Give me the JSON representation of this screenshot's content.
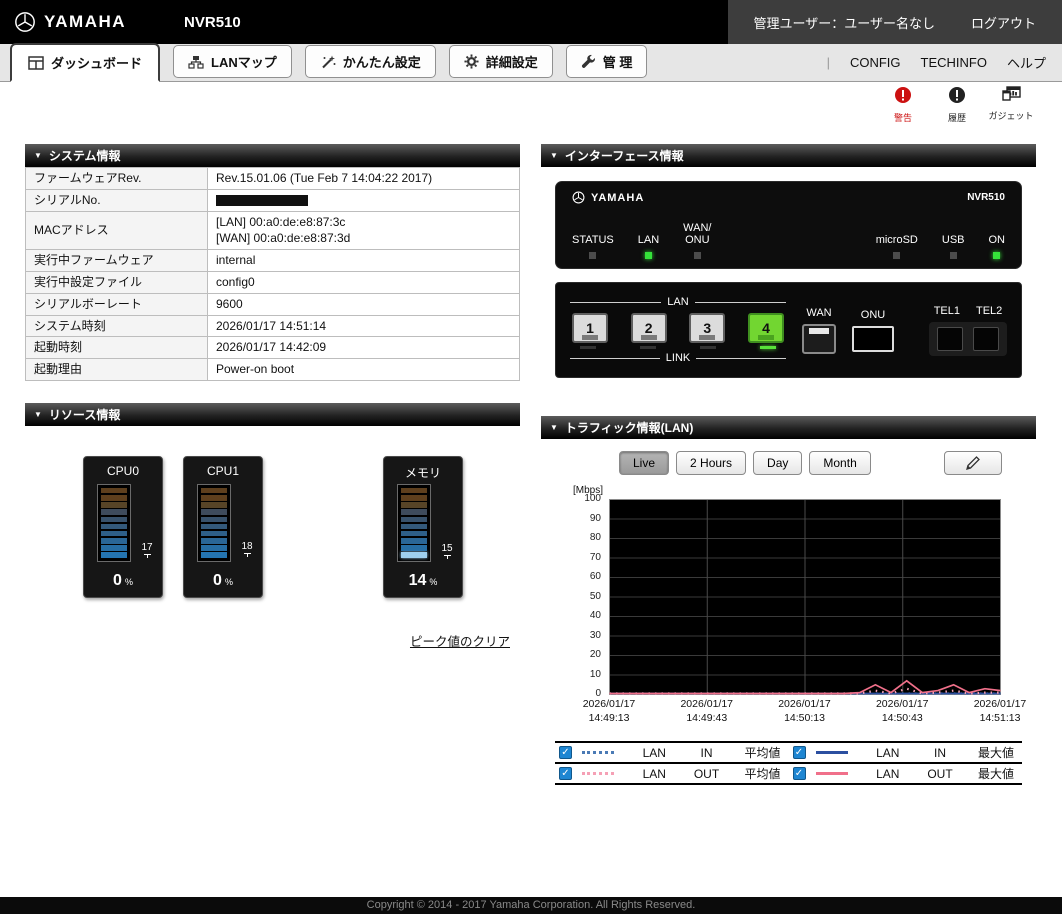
{
  "header": {
    "brand": "YAMAHA",
    "model": "NVR510",
    "user_label": "管理ユーザー：ユーザー名なし",
    "logout_label": "ログアウト"
  },
  "tabs": [
    {
      "id": "dashboard",
      "label": "ダッシュボード",
      "icon": "dashboard-icon",
      "active": true
    },
    {
      "id": "lanmap",
      "label": "LANマップ",
      "icon": "lanmap-icon",
      "active": false
    },
    {
      "id": "easy-setup",
      "label": "かんたん設定",
      "icon": "wand-icon",
      "active": false
    },
    {
      "id": "advanced",
      "label": "詳細設定",
      "icon": "gear-icon",
      "active": false
    },
    {
      "id": "admin",
      "label": "管 理",
      "icon": "wrench-icon",
      "active": false
    }
  ],
  "top_links": [
    {
      "id": "config",
      "label": "CONFIG"
    },
    {
      "id": "techinfo",
      "label": "TECHINFO"
    },
    {
      "id": "help",
      "label": "ヘルプ"
    }
  ],
  "notices": [
    {
      "id": "warning",
      "label": "警告",
      "icon": "warning-icon",
      "color": "#cc1111"
    },
    {
      "id": "history",
      "label": "履歴",
      "icon": "history-icon",
      "color": "#222222"
    },
    {
      "id": "gadget",
      "label": "ガジェット",
      "icon": "gadget-icon",
      "color": "#222222"
    }
  ],
  "system_info": {
    "title": "システム情報",
    "rows": [
      {
        "label": "ファームウェアRev.",
        "value": "Rev.15.01.06 (Tue Feb 7 14:04:22 2017)"
      },
      {
        "label": "シリアルNo.",
        "value": "",
        "redacted": true
      },
      {
        "label": "MACアドレス",
        "value": "[LAN] 00:a0:de:e8:87:3c\n[WAN] 00:a0:de:e8:87:3d"
      },
      {
        "label": "実行中ファームウェア",
        "value": "internal"
      },
      {
        "label": "実行中設定ファイル",
        "value": "config0"
      },
      {
        "label": "シリアルボーレート",
        "value": "9600"
      },
      {
        "label": "システム時刻",
        "value": "2026/01/17 14:51:14"
      },
      {
        "label": "起動時刻",
        "value": "2026/01/17 14:42:09"
      },
      {
        "label": "起動理由",
        "value": "Power-on boot"
      }
    ]
  },
  "resource_info": {
    "title": "リソース情報",
    "clear_link": "ピーク値のクリア",
    "gauges": [
      {
        "name": "CPU0",
        "value": 0,
        "unit": "%",
        "peak": 17
      },
      {
        "name": "CPU1",
        "value": 0,
        "unit": "%",
        "peak": 18
      },
      {
        "name": "メモリ",
        "value": 14,
        "unit": "%",
        "peak": 15
      }
    ]
  },
  "interface_info": {
    "title": "インターフェース情報",
    "front": {
      "brand": "YAMAHA",
      "model": "NVR510",
      "leds": [
        {
          "label": "STATUS",
          "on": false
        },
        {
          "label": "LAN",
          "on": true
        },
        {
          "label": "WAN/\nONU",
          "on": false
        },
        {
          "label": "microSD",
          "on": false
        },
        {
          "label": "USB",
          "on": false
        },
        {
          "label": "ON",
          "on": true
        }
      ]
    },
    "rear": {
      "lan_label": "LAN",
      "link_label": "LINK",
      "lan_ports": [
        {
          "number": "1",
          "active": false
        },
        {
          "number": "2",
          "active": false
        },
        {
          "number": "3",
          "active": false
        },
        {
          "number": "4",
          "active": true
        }
      ],
      "wan_label": "WAN",
      "onu_label": "ONU",
      "tel_labels": [
        "TEL1",
        "TEL2"
      ]
    }
  },
  "traffic": {
    "title": "トラフィック情報(LAN)",
    "buttons": [
      {
        "label": "Live",
        "active": true
      },
      {
        "label": "2 Hours",
        "active": false
      },
      {
        "label": "Day",
        "active": false
      },
      {
        "label": "Month",
        "active": false
      }
    ],
    "edit_icon": "pencil-icon",
    "legend": [
      {
        "interface": "LAN",
        "direction": "IN",
        "stat": "平均値",
        "style": "dotted",
        "color": "#4a7ab5",
        "checked": true
      },
      {
        "interface": "LAN",
        "direction": "IN",
        "stat": "最大値",
        "style": "solid",
        "color": "#2b4fa0",
        "checked": true
      },
      {
        "interface": "LAN",
        "direction": "OUT",
        "stat": "平均値",
        "style": "dotted",
        "color": "#f5a0b5",
        "checked": true
      },
      {
        "interface": "LAN",
        "direction": "OUT",
        "stat": "最大値",
        "style": "solid",
        "color": "#f0708a",
        "checked": true
      }
    ]
  },
  "chart_data": {
    "type": "line",
    "title": "トラフィック情報(LAN)",
    "ylabel": "[Mbps]",
    "xlabel": "",
    "ylim": [
      0,
      100
    ],
    "ytick_step": 10,
    "grid": true,
    "plot_bg": "#000000",
    "legend_position": "bottom",
    "x_labels": [
      "2026/01/17\n14:49:13",
      "2026/01/17\n14:49:43",
      "2026/01/17\n14:50:13",
      "2026/01/17\n14:50:43",
      "2026/01/17\n14:51:13"
    ],
    "series": [
      {
        "name": "LAN IN 平均値",
        "style": "dotted",
        "color": "#4a7ab5",
        "values": [
          0,
          0,
          0,
          0,
          0,
          0,
          0,
          0,
          0,
          0,
          0,
          0,
          0,
          0,
          0,
          0,
          0,
          0,
          0,
          0,
          0,
          0,
          0,
          0,
          0,
          0
        ]
      },
      {
        "name": "LAN IN 最大値",
        "style": "solid",
        "color": "#2b4fa0",
        "values": [
          0,
          0,
          0,
          0,
          0,
          0,
          0,
          0,
          0,
          0,
          0,
          0,
          0,
          0,
          0,
          0,
          0,
          0,
          0,
          0,
          0,
          0,
          0,
          0,
          0,
          0
        ]
      },
      {
        "name": "LAN OUT 平均値",
        "style": "dotted",
        "color": "#f5a0b5",
        "values": [
          0,
          0,
          0,
          0,
          0,
          0,
          0,
          0,
          0,
          0,
          0,
          0,
          0,
          0,
          0,
          0,
          0.5,
          2,
          0.5,
          3,
          0.5,
          1,
          2,
          0.5,
          1,
          1
        ]
      },
      {
        "name": "LAN OUT 最大値",
        "style": "solid",
        "color": "#f0708a",
        "values": [
          0,
          0,
          0,
          0,
          0,
          0,
          0,
          0,
          0,
          0,
          0,
          0,
          0,
          0,
          0,
          0,
          1,
          5,
          1,
          7,
          1,
          2,
          5,
          1,
          3,
          2
        ]
      }
    ]
  },
  "footer": {
    "copyright": "Copyright © 2014 - 2017 Yamaha Corporation. All Rights Reserved."
  }
}
